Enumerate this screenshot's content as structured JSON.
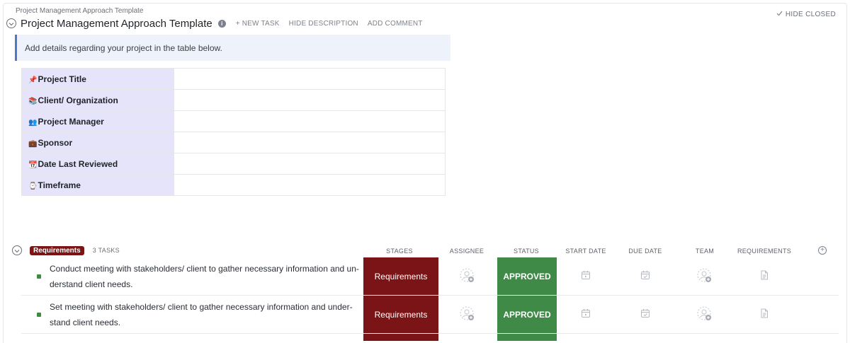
{
  "breadcrumb": "Project Management Approach Template",
  "header": {
    "title": "Project Management Approach Template",
    "new_task": "+ NEW TASK",
    "hide_description": "HIDE DESCRIPTION",
    "add_comment": "ADD COMMENT",
    "hide_closed": "HIDE CLOSED"
  },
  "description": "Add details regarding your project in the table below.",
  "details_table": [
    {
      "emoji": "📌",
      "label": "Project Title",
      "value": ""
    },
    {
      "emoji": "📚",
      "label": "Client/ Organization",
      "value": ""
    },
    {
      "emoji": "👥",
      "label": "Project Manager",
      "value": ""
    },
    {
      "emoji": "💼",
      "label": "Sponsor",
      "value": ""
    },
    {
      "emoji": "📆",
      "label": "Date Last Reviewed",
      "value": ""
    },
    {
      "emoji": "⌚",
      "label": "Timeframe",
      "value": ""
    }
  ],
  "group": {
    "name": "Requirements",
    "task_count": "3 TASKS",
    "badge_color": "#7b1416"
  },
  "columns": [
    "STAGES",
    "ASSIGNEE",
    "STATUS",
    "START DATE",
    "DUE DATE",
    "TEAM",
    "REQUIREMENTS"
  ],
  "tasks": [
    {
      "name": "Conduct meeting with stakeholders/ client to gather necessary information and un­derstand client needs.",
      "stage": "Requirements",
      "status": "APPROVED"
    },
    {
      "name": "Set meeting with stakeholders/ client to gather necessary information and under­stand client needs.",
      "stage": "Requirements",
      "status": "APPROVED"
    }
  ],
  "colors": {
    "stage": "#7b1416",
    "status_approved": "#3f8a47",
    "accent": "#4a79c9"
  }
}
